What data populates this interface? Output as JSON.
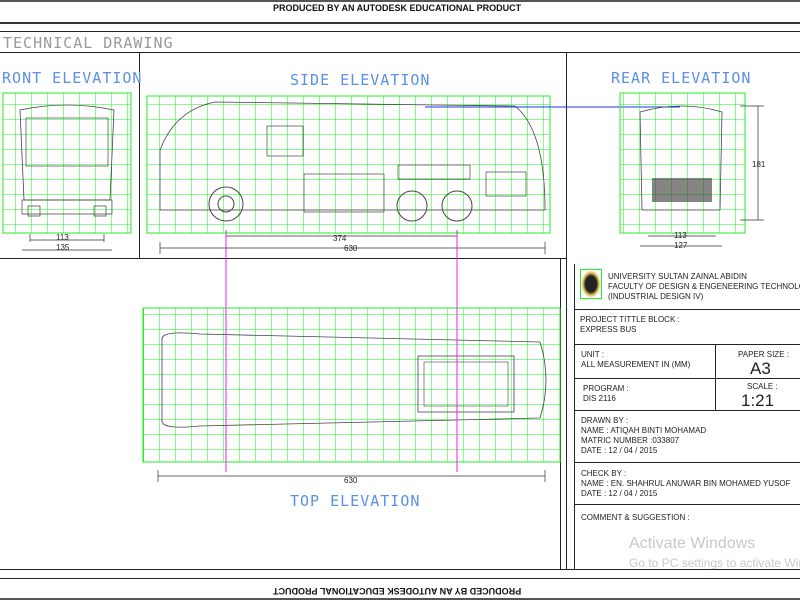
{
  "banner_top": "PRODUCED BY AN AUTODESK EDUCATIONAL PRODUCT",
  "banner_bottom": "PRODUCED BY AN AUTODESK EDUCATIONAL PRODUCT",
  "sheet_title": "TECHNICAL DRAWING",
  "views": {
    "front": {
      "title": "FRONT ELEVATION",
      "dims": [
        "113",
        "135"
      ]
    },
    "side": {
      "title": "SIDE ELEVATION",
      "dims": [
        "374",
        "630"
      ]
    },
    "rear": {
      "title": "REAR ELEVATION",
      "dims": [
        "113",
        "127",
        "181"
      ]
    },
    "top": {
      "title": "TOP ELEVATION",
      "dims": [
        "630"
      ]
    }
  },
  "title_block": {
    "university": "UNIVERSITY SULTAN ZAINAL ABIDIN",
    "faculty": "FACULTY OF DESIGN & ENGENEERING TECHNOLOGY",
    "course": "(INDUSTRIAL DESIGN IV)",
    "project_label": "PROJECT TITTLE BLOCK :",
    "project_value": "EXPRESS BUS",
    "unit_label": "UNIT :",
    "unit_value": "ALL MEASUREMENT  IN (MM)",
    "paper_label": "PAPER SIZE :",
    "paper_value": "A3",
    "program_label": "PROGRAM :",
    "program_value": "DIS 2116",
    "scale_label": "SCALE :",
    "scale_value": "1:21",
    "drawn_label": "DRAWN BY :",
    "drawn_name": "NAME : ATIQAH BINTI MOHAMAD",
    "drawn_matric": "MATRIC NUMBER :033807",
    "drawn_date": "DATE : 12 / 04 / 2015",
    "check_label": "CHECK BY :",
    "check_name": "NAME : EN. SHAHRUL ANUWAR BIN MOHAMED YUSOF",
    "check_date": "DATE : 12 / 04 / 2015",
    "comment_label": "COMMENT & SUGGESTION :"
  },
  "watermark": {
    "title": "Activate Windows",
    "subtitle": "Go to PC settings to activate Windows."
  },
  "colors": {
    "grid": "#22ee22",
    "title": "#5b8fe8",
    "guide": "#ee22ee",
    "blue_line": "#2233ee"
  }
}
